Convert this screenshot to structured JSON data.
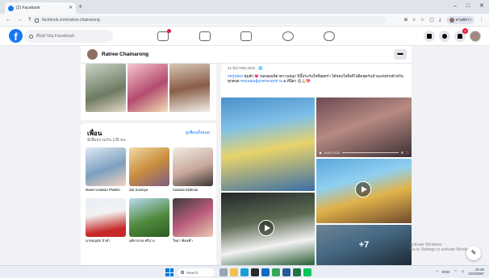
{
  "browser": {
    "tab_title": "(2) Facebook",
    "new_tab": "+",
    "url": "facebook.com/ratree.chainarong",
    "profile_label": "ทานต์ดาว",
    "min": "–",
    "max": "□",
    "close": "✕"
  },
  "fb": {
    "search_placeholder": "ค้นหาบน Facebook",
    "logo": "f",
    "notif_count": "2"
  },
  "profile": {
    "name": "Ratree Chainarong",
    "more": "▬"
  },
  "friends": {
    "title": "เพื่อน",
    "subtitle": "มีเพื่อนร่วมกัน 138 คน",
    "see_all": "ดูเพื่อนทั้งหมด",
    "items": [
      {
        "name": "Manw Uraiwan Phatkin"
      },
      {
        "name": "Juk Suranya"
      },
      {
        "name": "Sudarat Klabmai"
      },
      {
        "name": "นายบุญสุข บัวคำ"
      },
      {
        "name": "อุทัยวรรณ ศรีแวง"
      },
      {
        "name": "ใหม่า ฟ้อนฟ้า"
      }
    ]
  },
  "post": {
    "date": "21 ธันวาคม 2023 · 🌐",
    "text_a": "#ครูนล้อง",
    "text_b": " ชุมสัก 💗 ขอบคุณบิดาความสนุก ปีนี้ประกันใจที่สุดตรา ได้ขอบใจสิ่งดีไปดีดทุดกันบ้านแห่งทรงย้ายกันทุกคน5 ",
    "text_c": "#ขอบคุณผู้ปกครองทุกท่าน",
    "text_d": " & ที่นี่ดา 😊🙏💖",
    "video_time": "0:00 / 0:20",
    "more_count": "+7"
  },
  "windows": {
    "activate_line1": "Activate Windows",
    "activate_line2": "Go to Settings to activate Windows.",
    "search": "Search",
    "time": "15:30",
    "date": "12/4/2567",
    "lang": "ENG"
  },
  "colors": {
    "fb_blue": "#1877f2",
    "page_bg": "#f0f2f5",
    "badge_red": "#e41e3f"
  }
}
